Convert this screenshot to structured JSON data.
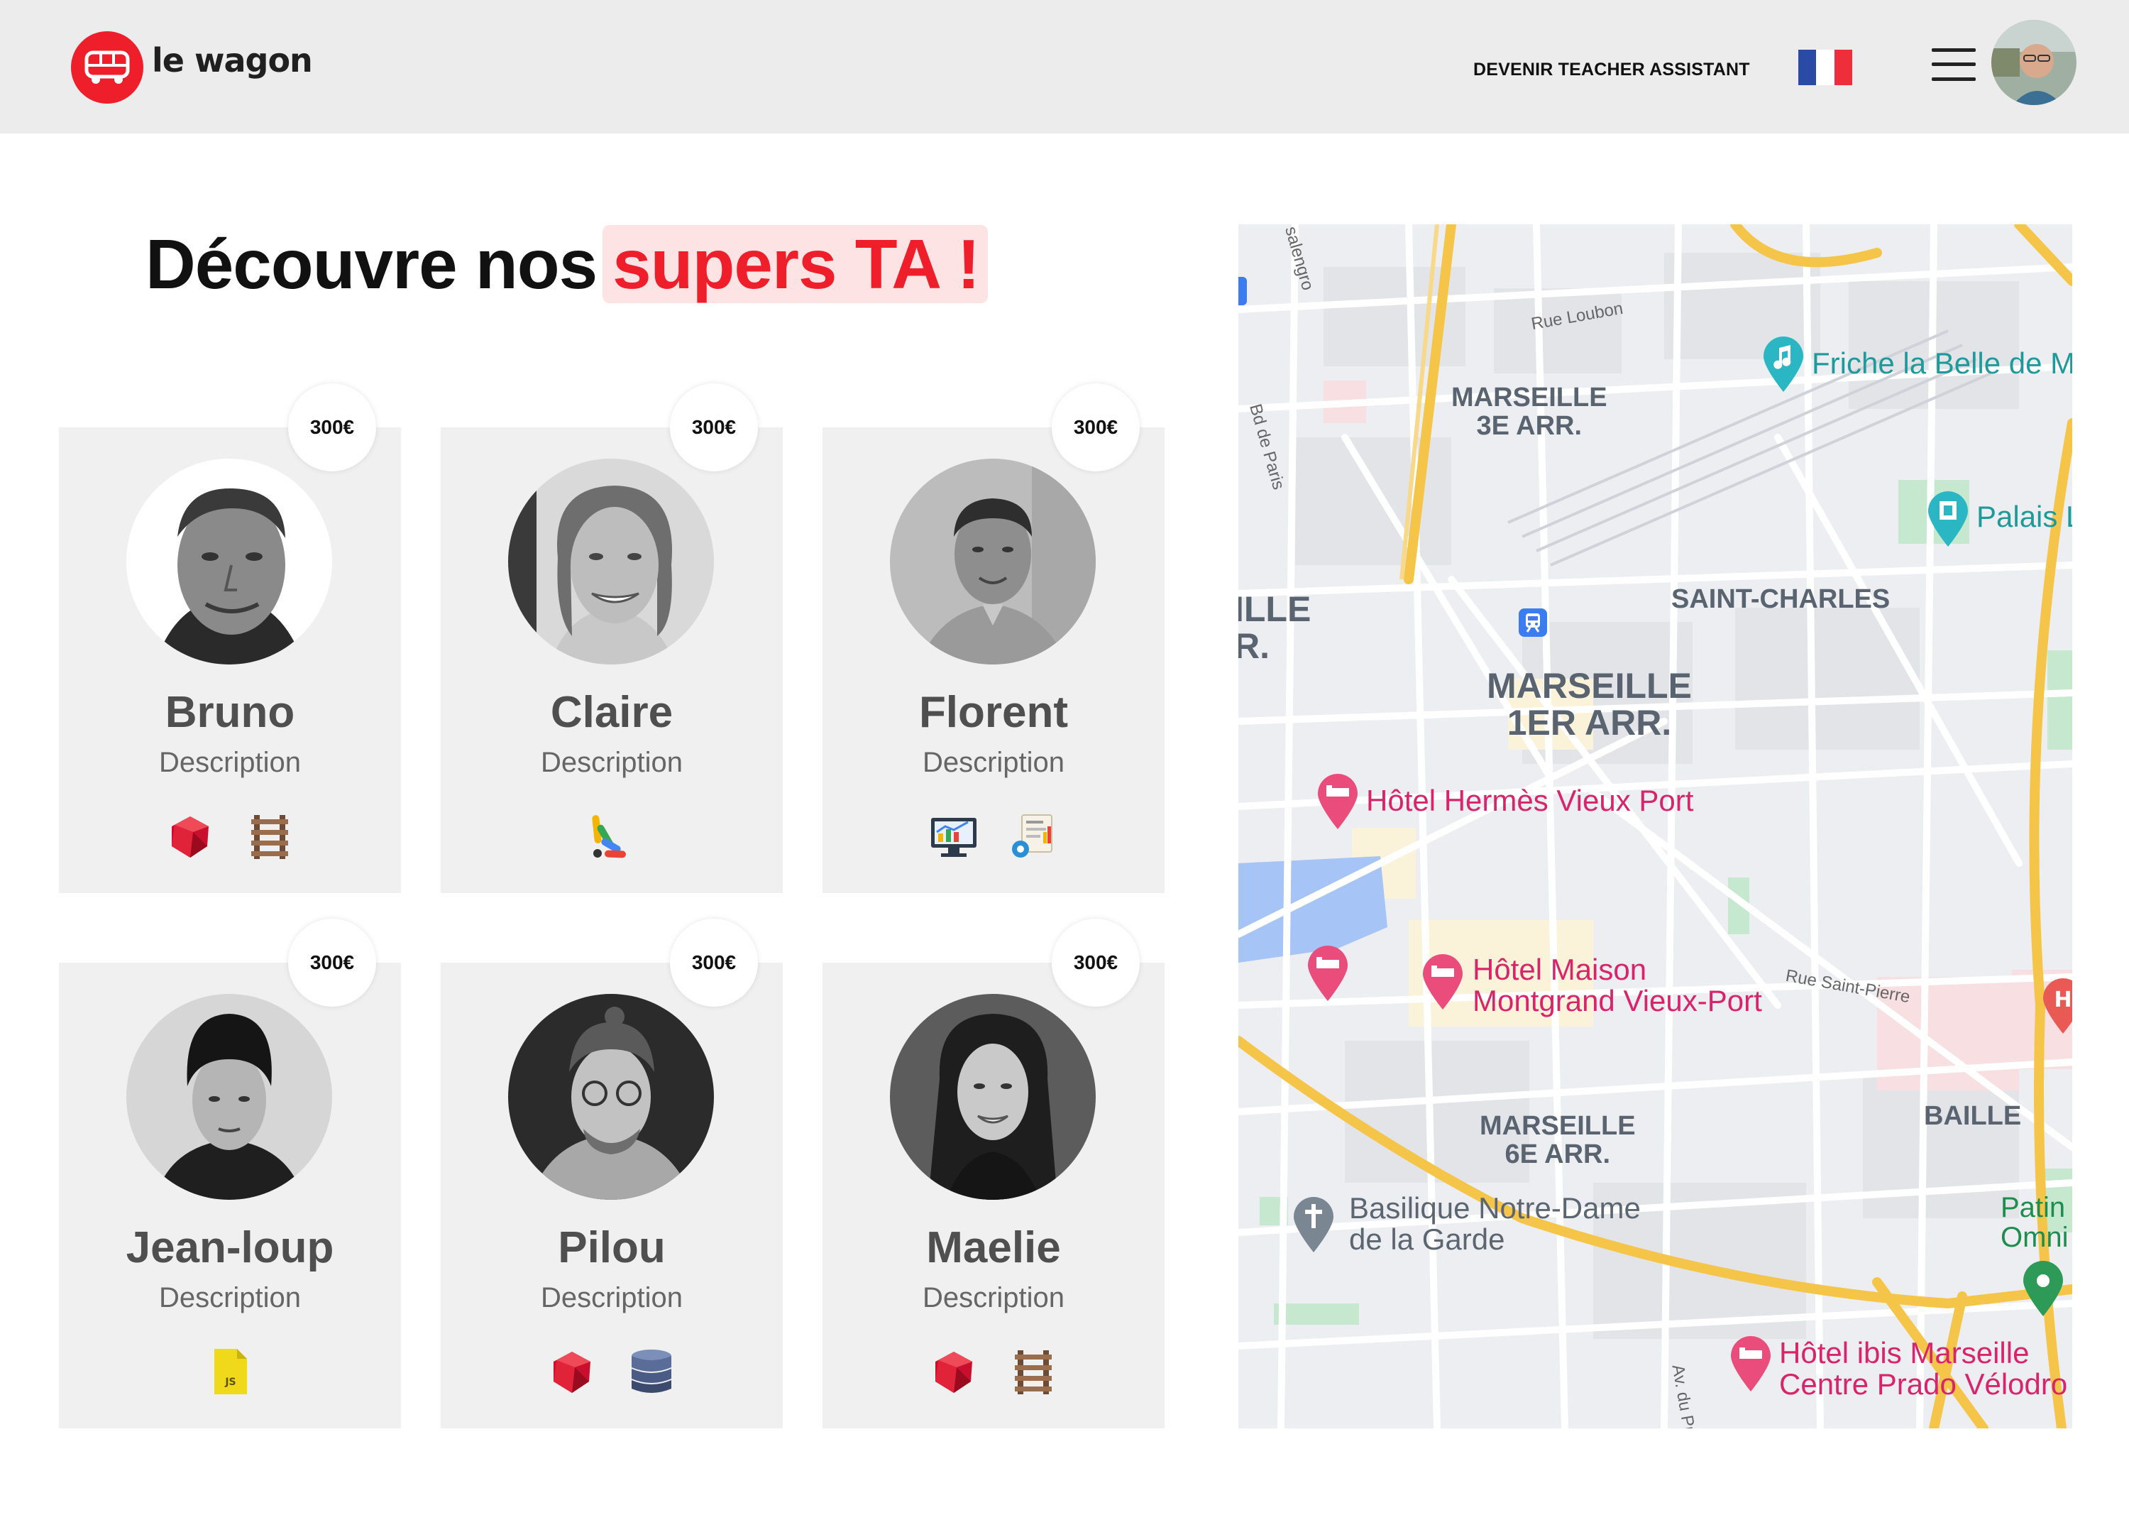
{
  "brand": {
    "name": "le wagon",
    "accent": "#ee1f2a"
  },
  "nav": {
    "link_label": "DEVENIR TEACHER ASSISTANT",
    "flag": "french-flag-icon",
    "menu_icon": "hamburger-icon"
  },
  "heading": {
    "prefix": "Découvre nos",
    "highlight": "supers TA !"
  },
  "cards": [
    {
      "name": "Bruno",
      "description": "Description",
      "price": "300€",
      "skills": [
        "ruby-icon",
        "rails-icon"
      ]
    },
    {
      "name": "Claire",
      "description": "Description",
      "price": "300€",
      "skills": [
        "design-palette-icon"
      ]
    },
    {
      "name": "Florent",
      "description": "Description",
      "price": "300€",
      "skills": [
        "analytics-monitor-icon",
        "report-settings-icon"
      ]
    },
    {
      "name": "Jean-loup",
      "description": "Description",
      "price": "300€",
      "skills": [
        "javascript-file-icon"
      ]
    },
    {
      "name": "Pilou",
      "description": "Description",
      "price": "300€",
      "skills": [
        "ruby-icon",
        "database-icon"
      ]
    },
    {
      "name": "Maelie",
      "description": "Description",
      "price": "300€",
      "skills": [
        "ruby-icon",
        "rails-icon"
      ]
    }
  ],
  "map": {
    "areas": [
      "MARSEILLE\n3E ARR.",
      "SAINT-CHARLES",
      "MARSEILLE\n1ER ARR.",
      "MARSEILLE\n6E ARR.",
      "BAILLE",
      "ILLE\nR."
    ],
    "pois": {
      "friche": "Friche la Belle de M",
      "palais": "Palais L",
      "hermes": "Hôtel Hermès Vieux Port",
      "maison": "Hôtel Maison\nMontgrand Vieux-Port",
      "basilique": "Basilique Notre-Dame\nde la Garde",
      "patin": "Patin\nOmni",
      "ibis": "Hôtel ibis Marseille\nCentre Prado Vélodro"
    },
    "streets": [
      "Rue Loubon",
      "Bd de Paris",
      "salengro",
      "Rue Saint-Pierre",
      "Av. du Pr"
    ]
  }
}
